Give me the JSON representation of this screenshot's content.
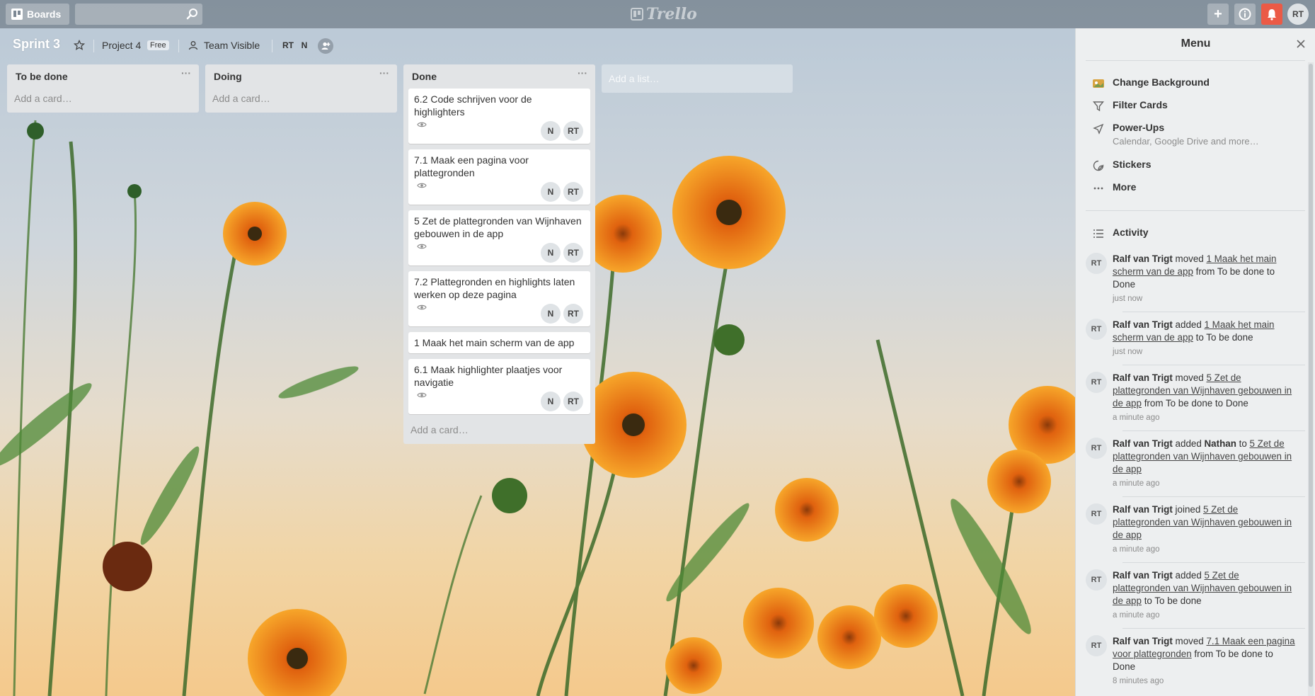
{
  "header": {
    "boards_label": "Boards",
    "search_placeholder": "",
    "logo_text": "Trello",
    "add_label": "+",
    "info_label": "i",
    "user_initials": "RT"
  },
  "board": {
    "title": "Sprint 3",
    "org_name": "Project 4",
    "org_badge": "Free",
    "visibility": "Team Visible",
    "members": [
      "RT",
      "N"
    ]
  },
  "lists": [
    {
      "title": "To be done",
      "add_card": "Add a card…",
      "cards": []
    },
    {
      "title": "Doing",
      "add_card": "Add a card…",
      "cards": []
    },
    {
      "title": "Done",
      "add_card": "Add a card…",
      "cards": [
        {
          "title": "6.2 Code schrijven voor de highlighters",
          "members": [
            "N",
            "RT"
          ]
        },
        {
          "title": "7.1 Maak een pagina voor plattegronden",
          "members": [
            "N",
            "RT"
          ]
        },
        {
          "title": "5 Zet de plattegronden van Wijnhaven gebouwen in de app",
          "members": [
            "N",
            "RT"
          ]
        },
        {
          "title": "7.2 Plattegronden en highlights laten werken op deze pagina",
          "members": [
            "N",
            "RT"
          ]
        },
        {
          "title": "1 Maak het main scherm van de app",
          "members": []
        },
        {
          "title": "6.1 Maak highlighter plaatjes voor navigatie",
          "members": [
            "N",
            "RT"
          ]
        }
      ]
    }
  ],
  "add_list": "Add a list…",
  "menu": {
    "title": "Menu",
    "items": [
      {
        "label": "Change Background",
        "sub": ""
      },
      {
        "label": "Filter Cards",
        "sub": ""
      },
      {
        "label": "Power-Ups",
        "sub": "Calendar, Google Drive and more…"
      },
      {
        "label": "Stickers",
        "sub": ""
      },
      {
        "label": "More",
        "sub": ""
      }
    ],
    "activity_title": "Activity",
    "activity": [
      {
        "initials": "RT",
        "user": "Ralf van Trigt",
        "action": " moved ",
        "target": "1 Maak het main scherm van de app",
        "rest": " from To be done to Done",
        "time": "just now"
      },
      {
        "initials": "RT",
        "user": "Ralf van Trigt",
        "action": " added ",
        "target": "1 Maak het main scherm van de app",
        "rest": " to To be done",
        "time": "just now"
      },
      {
        "initials": "RT",
        "user": "Ralf van Trigt",
        "action": " moved ",
        "target": "5 Zet de plattegronden van Wijnhaven gebouwen in de app",
        "rest": " from To be done to Done",
        "time": "a minute ago"
      },
      {
        "initials": "RT",
        "user": "Ralf van Trigt",
        "action": " added ",
        "extra_bold": "Nathan",
        "action2": " to ",
        "target": "5 Zet de plattegronden van Wijnhaven gebouwen in de app",
        "rest": "",
        "time": "a minute ago"
      },
      {
        "initials": "RT",
        "user": "Ralf van Trigt",
        "action": " joined ",
        "target": "5 Zet de plattegronden van Wijnhaven gebouwen in de app",
        "rest": "",
        "time": "a minute ago"
      },
      {
        "initials": "RT",
        "user": "Ralf van Trigt",
        "action": " added ",
        "target": "5 Zet de plattegronden van Wijnhaven gebouwen in de app",
        "rest": " to To be done",
        "time": "a minute ago"
      },
      {
        "initials": "RT",
        "user": "Ralf van Trigt",
        "action": " moved ",
        "target": "7.1 Maak een pagina voor plattegronden",
        "rest": " from To be done to Done",
        "time": "8 minutes ago"
      }
    ]
  },
  "colors": {
    "accent_notification": "#eb5a46",
    "list_bg": "#e2e4e6",
    "menu_bg": "#edeff0"
  }
}
